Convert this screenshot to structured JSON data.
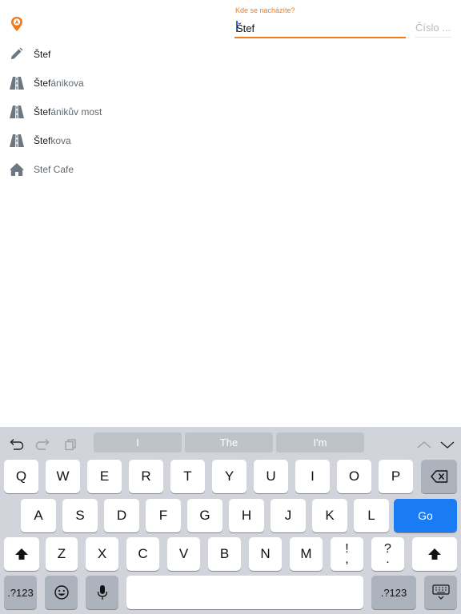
{
  "header": {
    "field_label": "Kde se nacházíte?",
    "street_value": "Štef",
    "number_placeholder": "Číslo ..."
  },
  "suggestions": [
    {
      "icon": "pencil-icon",
      "match": "Štef",
      "rest": ""
    },
    {
      "icon": "road-icon",
      "match": "Štef",
      "rest": "ánikova"
    },
    {
      "icon": "road-icon",
      "match": "Štef",
      "rest": "ánikův most"
    },
    {
      "icon": "road-icon",
      "match": "Štef",
      "rest": "kova"
    },
    {
      "icon": "home-icon",
      "match": "",
      "rest": "Stef Cafe"
    }
  ],
  "keyboard": {
    "predictions": [
      "I",
      "The",
      "I'm"
    ],
    "row1": [
      "Q",
      "W",
      "E",
      "R",
      "T",
      "Y",
      "U",
      "I",
      "O",
      "P"
    ],
    "row2": [
      "A",
      "S",
      "D",
      "F",
      "G",
      "H",
      "J",
      "K",
      "L"
    ],
    "row3": [
      "Z",
      "X",
      "C",
      "V",
      "B",
      "N",
      "M"
    ],
    "punct1_top": "!",
    "punct1_bottom": ",",
    "punct2_top": "?",
    "punct2_bottom": ".",
    "go_label": "Go",
    "numbers_label": ".?123"
  },
  "colors": {
    "accent": "#f07b1c",
    "go_key": "#1a7cf5",
    "keyboard_bg": "#d1d5db"
  }
}
